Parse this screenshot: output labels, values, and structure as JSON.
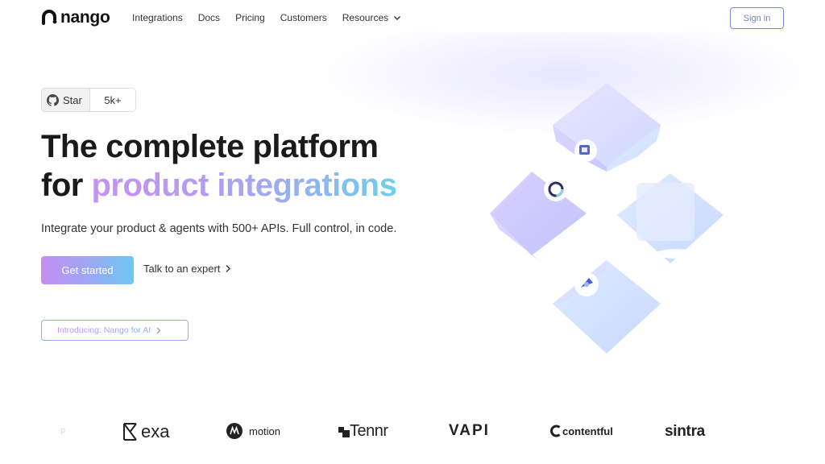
{
  "nav": {
    "brand": "nango",
    "items": [
      {
        "label": "Integrations"
      },
      {
        "label": "Docs"
      },
      {
        "label": "Pricing"
      },
      {
        "label": "Customers"
      },
      {
        "label": "Resources"
      }
    ],
    "sign_in": "Sign in"
  },
  "github": {
    "star_label": "Star",
    "count": "5k+"
  },
  "hero": {
    "title_line1": "The complete platform",
    "title_line2_prefix": "for ",
    "title_line2_highlight": "product integrations",
    "subtitle": "Integrate your product & agents with 500+ APIs. Full control, in code.",
    "cta_primary": "Get started",
    "cta_secondary": "Talk to an expert",
    "announcement": "Introducing: Nango for AI"
  },
  "customers": [
    {
      "name": "exa"
    },
    {
      "name": "motion"
    },
    {
      "name": "Tennr"
    },
    {
      "name": "VAPI"
    },
    {
      "name": "contentful"
    },
    {
      "name": "sintra"
    }
  ],
  "colors": {
    "accent_purple": "#c48ef2",
    "accent_blue": "#6cc8ef",
    "sign_in_border": "#7b8cd6"
  }
}
